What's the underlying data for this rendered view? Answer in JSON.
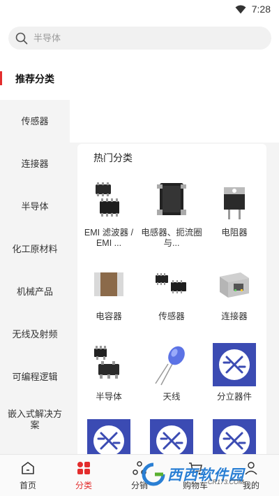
{
  "status": {
    "time": "7:28"
  },
  "search": {
    "placeholder": "半导体"
  },
  "sidebar": {
    "items": [
      {
        "label": "推荐分类",
        "active": true
      },
      {
        "label": "传感器"
      },
      {
        "label": "连接器"
      },
      {
        "label": "半导体"
      },
      {
        "label": "化工原材料"
      },
      {
        "label": "机械产品"
      },
      {
        "label": "无线及射频"
      },
      {
        "label": "可编程逻辑"
      },
      {
        "label": "嵌入式解决方案"
      }
    ]
  },
  "main": {
    "section_title": "热门分类",
    "categories": [
      {
        "label": "EMI 滤波器 / EMI ...",
        "icon": "ic-chip-icon"
      },
      {
        "label": "电感器、扼流圈与...",
        "icon": "inductor-icon"
      },
      {
        "label": "电阻器",
        "icon": "power-resistor-icon"
      },
      {
        "label": "电容器",
        "icon": "capacitor-icon"
      },
      {
        "label": "传感器",
        "icon": "sensor-chip-icon"
      },
      {
        "label": "连接器",
        "icon": "rj45-connector-icon"
      },
      {
        "label": "半导体",
        "icon": "sot-chip-icon"
      },
      {
        "label": "天线",
        "icon": "led-antenna-icon"
      },
      {
        "label": "分立器件",
        "icon": "circuit-logo-icon"
      },
      {
        "label": "",
        "icon": "circuit-logo-icon"
      },
      {
        "label": "",
        "icon": "circuit-logo-icon"
      },
      {
        "label": "",
        "icon": "circuit-logo-icon"
      }
    ]
  },
  "tabbar": {
    "tabs": [
      {
        "label": "首页",
        "icon": "home-icon"
      },
      {
        "label": "分类",
        "icon": "category-icon",
        "active": true
      },
      {
        "label": "分销",
        "icon": "distribution-icon"
      },
      {
        "label": "购物车",
        "icon": "cart-icon"
      },
      {
        "label": "我的",
        "icon": "profile-icon"
      }
    ]
  },
  "watermark": {
    "text": "西西软件园",
    "sub": "CR173.COM"
  },
  "colors": {
    "accent": "#e32d2d",
    "logo_blue": "#3b4bb3"
  }
}
